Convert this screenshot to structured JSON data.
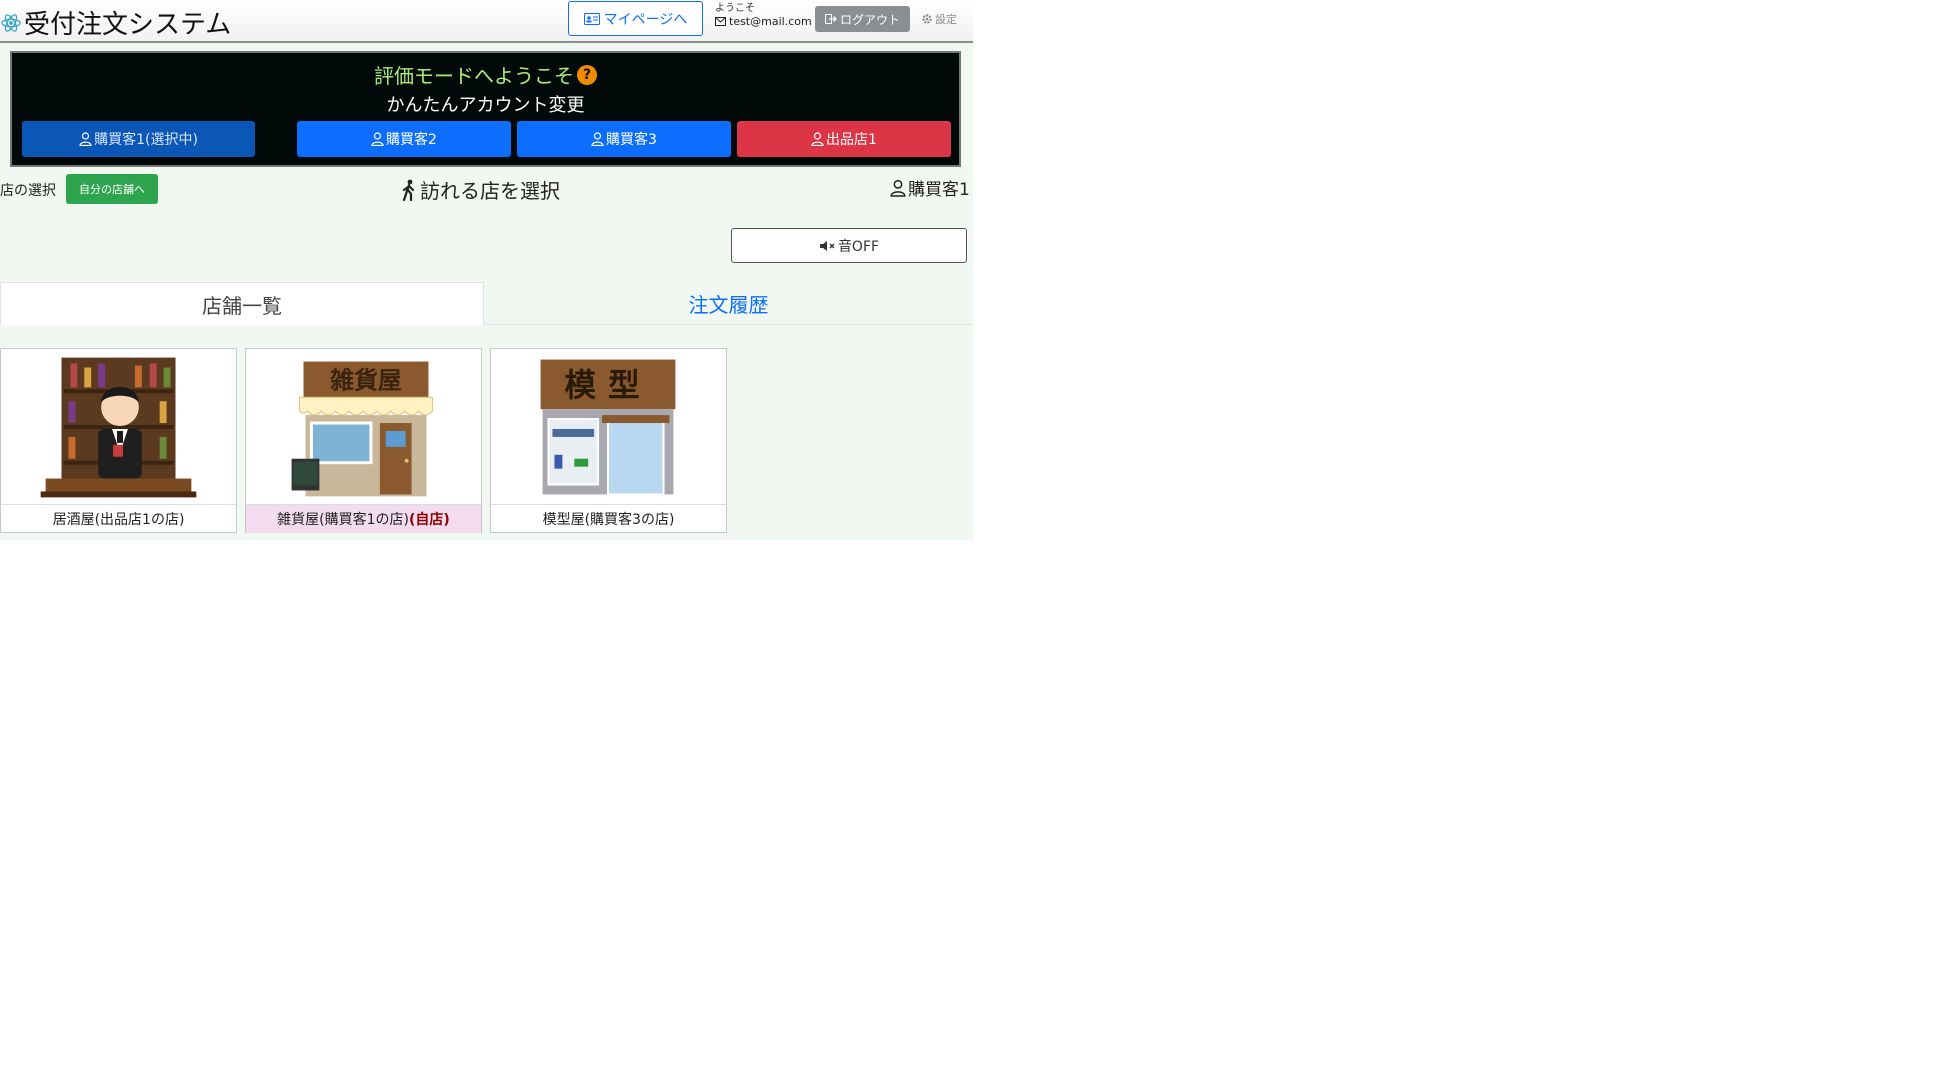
{
  "header": {
    "app_title": "受付注文システム",
    "mypage_label": "マイページへ",
    "welcome_label": "ようこそ",
    "user_email": "test@mail.com",
    "logout_label": "ログアウト",
    "settings_label": "設定"
  },
  "banner": {
    "title": "評価モードへようこそ",
    "subtitle": "かんたんアカウント変更",
    "accounts": [
      {
        "label": "購買客1(選択中)",
        "color": "#0b57b8",
        "selected": true
      },
      {
        "label": "購買客2",
        "color": "#0d6efd",
        "selected": false
      },
      {
        "label": "購買客3",
        "color": "#0d6efd",
        "selected": false
      },
      {
        "label": "出品店1",
        "color": "#dc3545",
        "selected": false
      }
    ]
  },
  "subheader": {
    "store_select_label": "店の選択",
    "own_store_button": "自分の店舗へ",
    "heading": "訪れる店を選択",
    "current_user": "購買客1"
  },
  "sound_button_label": "音OFF",
  "tabs": [
    {
      "label": "店舗一覧",
      "active": true
    },
    {
      "label": "注文履歴",
      "active": false
    }
  ],
  "stores": [
    {
      "name": "居酒屋(出品店1の店)",
      "own": false,
      "own_mark": "",
      "icon": "izakaya-bartender-illustration"
    },
    {
      "name": "雑貨屋(購買客1の店)",
      "own": true,
      "own_mark": "(自店)",
      "sign": "雑貨屋",
      "icon": "general-store-illustration"
    },
    {
      "name": "模型屋(購買客3の店)",
      "own": false,
      "own_mark": "",
      "sign": "模型",
      "icon": "model-shop-illustration"
    }
  ],
  "colors": {
    "page_bg": "#f1f8f1",
    "banner_bg": "#020909",
    "banner_title": "#a9ec7a",
    "primary": "#0d6efd",
    "danger": "#dc3545",
    "success": "#2ea44f"
  }
}
